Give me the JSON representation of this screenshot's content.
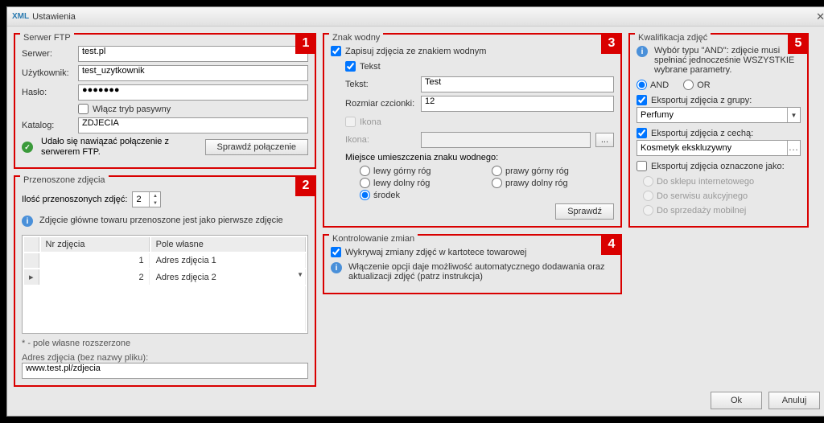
{
  "window": {
    "prefix": "XML",
    "title": "Ustawienia"
  },
  "markers": {
    "m1": "1",
    "m2": "2",
    "m3": "3",
    "m4": "4",
    "m5": "5"
  },
  "ftp": {
    "legend": "Serwer FTP",
    "server_lbl": "Serwer:",
    "server_val": "test.pl",
    "user_lbl": "Użytkownik:",
    "user_val": "test_uzytkownik",
    "pass_lbl": "Hasło:",
    "pass_val": "●●●●●●●",
    "passive_lbl": "Włącz tryb pasywny",
    "dir_lbl": "Katalog:",
    "dir_val": "ZDJECIA",
    "status": "Udało się nawiązać połączenie z serwerem FTP.",
    "check_btn": "Sprawdź połączenie"
  },
  "transfer": {
    "legend": "Przenoszone zdjęcia",
    "count_lbl": "Ilość przenoszonych zdjęć:",
    "count_val": "2",
    "info": "Zdjęcie główne towaru przenoszone jest jako pierwsze zdjęcie",
    "col_nr": "Nr zdjęcia",
    "col_field": "Pole własne",
    "r1_nr": "1",
    "r1_field": "Adres zdjęcia 1",
    "r2_nr": "2",
    "r2_field": "Adres zdjęcia 2",
    "note": "* - pole własne rozszerzone",
    "url_lbl": "Adres zdjęcia (bez nazwy pliku):",
    "url_val": "www.test.pl/zdjecia"
  },
  "watermark": {
    "legend": "Znak wodny",
    "save_lbl": "Zapisuj zdjęcia ze znakiem wodnym",
    "text_chk": "Tekst",
    "text_lbl": "Tekst:",
    "text_val": "Test",
    "font_lbl": "Rozmiar czcionki:",
    "font_val": "12",
    "icon_chk": "Ikona",
    "icon_lbl": "Ikona:",
    "place_lbl": "Miejsce umieszczenia znaku wodnego:",
    "pos_tl": "lewy górny róg",
    "pos_tr": "prawy górny róg",
    "pos_bl": "lewy dolny róg",
    "pos_br": "prawy dolny róg",
    "pos_c": "środek",
    "check_btn": "Sprawdź"
  },
  "changes": {
    "legend": "Kontrolowanie zmian",
    "detect_lbl": "Wykrywaj zmiany zdjęć w kartotece towarowej",
    "info": "Włączenie opcji daje możliwość automatycznego dodawania oraz aktualizacji zdjęć (patrz instrukcja)"
  },
  "qual": {
    "legend": "Kwalifikacja zdjęć",
    "info": "Wybór typu \"AND\": zdjęcie musi spełniać jednocześnie WSZYSTKIE wybrane parametry.",
    "and": "AND",
    "or": "OR",
    "group_lbl": "Eksportuj zdjęcia z grupy:",
    "group_val": "Perfumy",
    "attr_lbl": "Eksportuj zdjęcia z cechą:",
    "attr_val": "Kosmetyk ekskluzywny",
    "mark_lbl": "Eksportuj zdjęcia oznaczone jako:",
    "opt_shop": "Do sklepu internetowego",
    "opt_auction": "Do serwisu aukcyjnego",
    "opt_mobile": "Do sprzedaży mobilnej"
  },
  "footer": {
    "ok": "Ok",
    "cancel": "Anuluj"
  }
}
